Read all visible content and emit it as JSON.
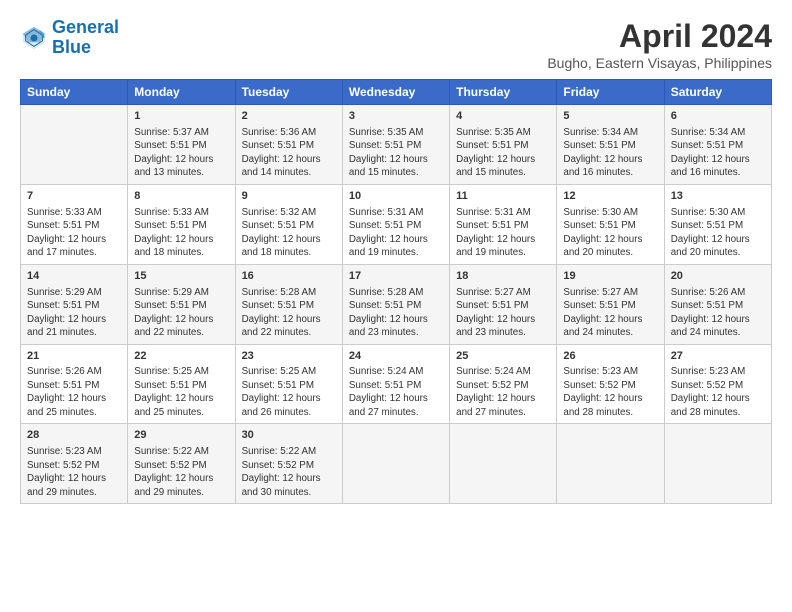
{
  "header": {
    "logo_line1": "General",
    "logo_line2": "Blue",
    "title": "April 2024",
    "subtitle": "Bugho, Eastern Visayas, Philippines"
  },
  "columns": [
    "Sunday",
    "Monday",
    "Tuesday",
    "Wednesday",
    "Thursday",
    "Friday",
    "Saturday"
  ],
  "weeks": [
    [
      {
        "day": "",
        "info": ""
      },
      {
        "day": "1",
        "info": "Sunrise: 5:37 AM\nSunset: 5:51 PM\nDaylight: 12 hours\nand 13 minutes."
      },
      {
        "day": "2",
        "info": "Sunrise: 5:36 AM\nSunset: 5:51 PM\nDaylight: 12 hours\nand 14 minutes."
      },
      {
        "day": "3",
        "info": "Sunrise: 5:35 AM\nSunset: 5:51 PM\nDaylight: 12 hours\nand 15 minutes."
      },
      {
        "day": "4",
        "info": "Sunrise: 5:35 AM\nSunset: 5:51 PM\nDaylight: 12 hours\nand 15 minutes."
      },
      {
        "day": "5",
        "info": "Sunrise: 5:34 AM\nSunset: 5:51 PM\nDaylight: 12 hours\nand 16 minutes."
      },
      {
        "day": "6",
        "info": "Sunrise: 5:34 AM\nSunset: 5:51 PM\nDaylight: 12 hours\nand 16 minutes."
      }
    ],
    [
      {
        "day": "7",
        "info": "Sunrise: 5:33 AM\nSunset: 5:51 PM\nDaylight: 12 hours\nand 17 minutes."
      },
      {
        "day": "8",
        "info": "Sunrise: 5:33 AM\nSunset: 5:51 PM\nDaylight: 12 hours\nand 18 minutes."
      },
      {
        "day": "9",
        "info": "Sunrise: 5:32 AM\nSunset: 5:51 PM\nDaylight: 12 hours\nand 18 minutes."
      },
      {
        "day": "10",
        "info": "Sunrise: 5:31 AM\nSunset: 5:51 PM\nDaylight: 12 hours\nand 19 minutes."
      },
      {
        "day": "11",
        "info": "Sunrise: 5:31 AM\nSunset: 5:51 PM\nDaylight: 12 hours\nand 19 minutes."
      },
      {
        "day": "12",
        "info": "Sunrise: 5:30 AM\nSunset: 5:51 PM\nDaylight: 12 hours\nand 20 minutes."
      },
      {
        "day": "13",
        "info": "Sunrise: 5:30 AM\nSunset: 5:51 PM\nDaylight: 12 hours\nand 20 minutes."
      }
    ],
    [
      {
        "day": "14",
        "info": "Sunrise: 5:29 AM\nSunset: 5:51 PM\nDaylight: 12 hours\nand 21 minutes."
      },
      {
        "day": "15",
        "info": "Sunrise: 5:29 AM\nSunset: 5:51 PM\nDaylight: 12 hours\nand 22 minutes."
      },
      {
        "day": "16",
        "info": "Sunrise: 5:28 AM\nSunset: 5:51 PM\nDaylight: 12 hours\nand 22 minutes."
      },
      {
        "day": "17",
        "info": "Sunrise: 5:28 AM\nSunset: 5:51 PM\nDaylight: 12 hours\nand 23 minutes."
      },
      {
        "day": "18",
        "info": "Sunrise: 5:27 AM\nSunset: 5:51 PM\nDaylight: 12 hours\nand 23 minutes."
      },
      {
        "day": "19",
        "info": "Sunrise: 5:27 AM\nSunset: 5:51 PM\nDaylight: 12 hours\nand 24 minutes."
      },
      {
        "day": "20",
        "info": "Sunrise: 5:26 AM\nSunset: 5:51 PM\nDaylight: 12 hours\nand 24 minutes."
      }
    ],
    [
      {
        "day": "21",
        "info": "Sunrise: 5:26 AM\nSunset: 5:51 PM\nDaylight: 12 hours\nand 25 minutes."
      },
      {
        "day": "22",
        "info": "Sunrise: 5:25 AM\nSunset: 5:51 PM\nDaylight: 12 hours\nand 25 minutes."
      },
      {
        "day": "23",
        "info": "Sunrise: 5:25 AM\nSunset: 5:51 PM\nDaylight: 12 hours\nand 26 minutes."
      },
      {
        "day": "24",
        "info": "Sunrise: 5:24 AM\nSunset: 5:51 PM\nDaylight: 12 hours\nand 27 minutes."
      },
      {
        "day": "25",
        "info": "Sunrise: 5:24 AM\nSunset: 5:52 PM\nDaylight: 12 hours\nand 27 minutes."
      },
      {
        "day": "26",
        "info": "Sunrise: 5:23 AM\nSunset: 5:52 PM\nDaylight: 12 hours\nand 28 minutes."
      },
      {
        "day": "27",
        "info": "Sunrise: 5:23 AM\nSunset: 5:52 PM\nDaylight: 12 hours\nand 28 minutes."
      }
    ],
    [
      {
        "day": "28",
        "info": "Sunrise: 5:23 AM\nSunset: 5:52 PM\nDaylight: 12 hours\nand 29 minutes."
      },
      {
        "day": "29",
        "info": "Sunrise: 5:22 AM\nSunset: 5:52 PM\nDaylight: 12 hours\nand 29 minutes."
      },
      {
        "day": "30",
        "info": "Sunrise: 5:22 AM\nSunset: 5:52 PM\nDaylight: 12 hours\nand 30 minutes."
      },
      {
        "day": "",
        "info": ""
      },
      {
        "day": "",
        "info": ""
      },
      {
        "day": "",
        "info": ""
      },
      {
        "day": "",
        "info": ""
      }
    ]
  ]
}
